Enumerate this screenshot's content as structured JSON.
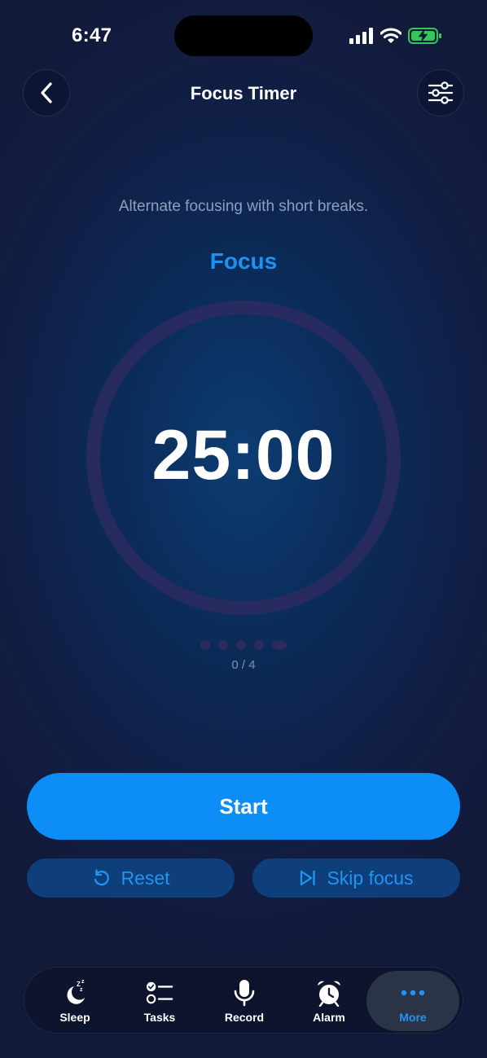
{
  "status_bar": {
    "time": "6:47"
  },
  "nav": {
    "title": "Focus Timer"
  },
  "description": "Alternate focusing with short breaks.",
  "phase_label": "Focus",
  "timer": {
    "display": "25:00",
    "sessions_completed": 0,
    "sessions_total": 4,
    "progress_text": "0 / 4"
  },
  "actions": {
    "start_label": "Start",
    "reset_label": "Reset",
    "skip_label": "Skip focus"
  },
  "tabs": [
    {
      "label": "Sleep",
      "icon": "moon-zzz-icon"
    },
    {
      "label": "Tasks",
      "icon": "checklist-icon"
    },
    {
      "label": "Record",
      "icon": "microphone-icon"
    },
    {
      "label": "Alarm",
      "icon": "alarm-clock-icon"
    },
    {
      "label": "More",
      "icon": "ellipsis-icon",
      "active": true
    }
  ],
  "colors": {
    "accent": "#0d8ef7",
    "phase": "#1b93f5",
    "ring": "#2d2a5f",
    "battery": "#34c759"
  }
}
